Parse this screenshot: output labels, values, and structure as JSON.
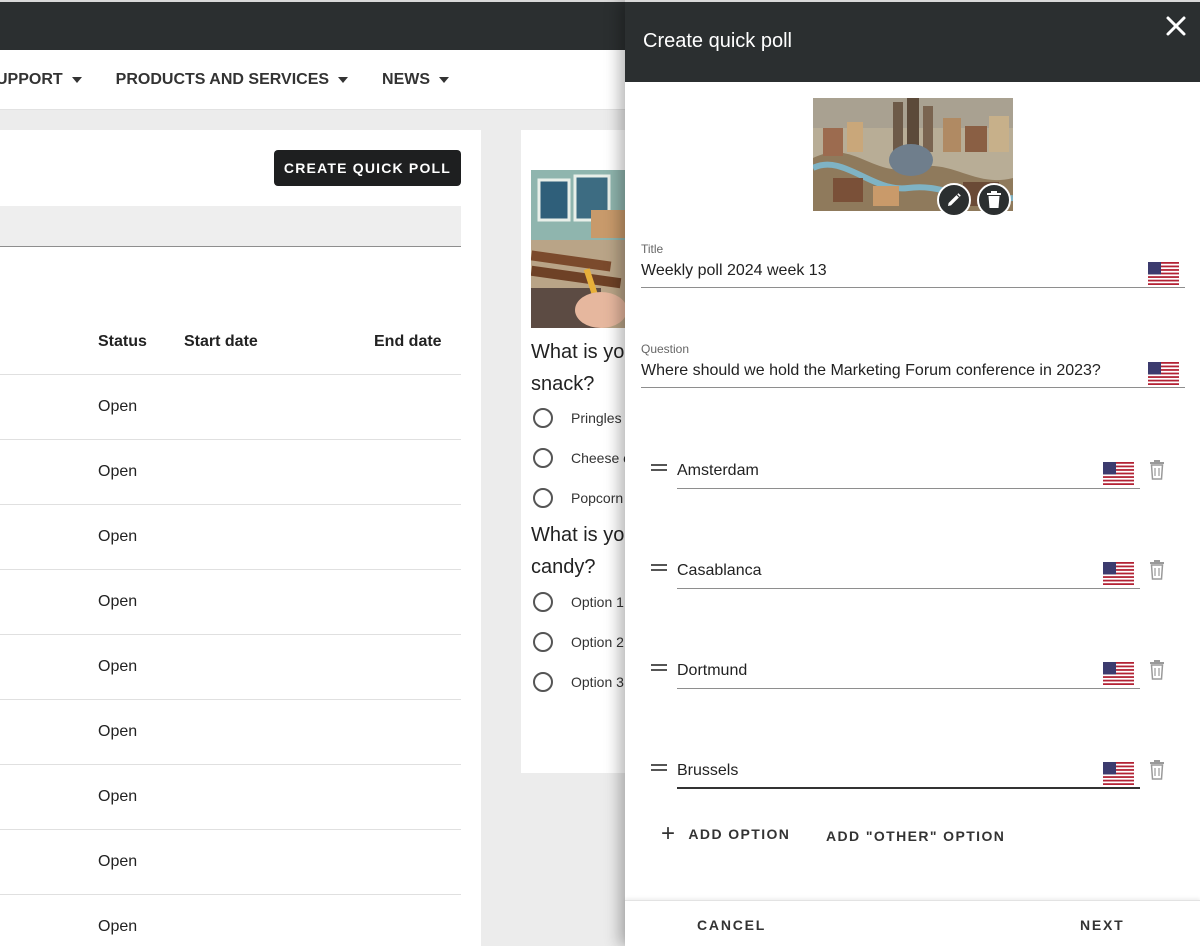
{
  "nav": {
    "items": [
      {
        "label": "UPPORT"
      },
      {
        "label": "PRODUCTS AND SERVICES"
      },
      {
        "label": "NEWS"
      }
    ]
  },
  "list": {
    "create_button": "CREATE QUICK POLL",
    "columns": {
      "status": "Status",
      "start": "Start date",
      "end": "End date"
    },
    "rows": [
      {
        "status": "Open"
      },
      {
        "status": "Open"
      },
      {
        "status": "Open"
      },
      {
        "status": "Open"
      },
      {
        "status": "Open"
      },
      {
        "status": "Open"
      },
      {
        "status": "Open"
      },
      {
        "status": "Open"
      },
      {
        "status": "Open"
      }
    ]
  },
  "preview": {
    "q1": {
      "line1": "What is yo",
      "line2": "snack?"
    },
    "q1_options": [
      "Pringles",
      "Cheese c",
      "Popcorn"
    ],
    "q2": {
      "line1": "What is yo",
      "line2": "candy?"
    },
    "q2_options": [
      "Option 1",
      "Option 2",
      "Option 3"
    ]
  },
  "drawer": {
    "title": "Create quick poll",
    "title_field": {
      "label": "Title",
      "value": "Weekly poll 2024 week 13"
    },
    "question_field": {
      "label": "Question",
      "value": "Where should we hold the Marketing Forum conference in 2023?"
    },
    "options": [
      {
        "value": "Amsterdam"
      },
      {
        "value": "Casablanca"
      },
      {
        "value": "Dortmund"
      },
      {
        "value": "Brussels"
      }
    ],
    "add_option": "ADD OPTION",
    "add_other": "ADD \"OTHER\" OPTION",
    "cancel": "CANCEL",
    "next": "NEXT"
  },
  "icons": {
    "close": "close-icon",
    "edit": "pencil-icon",
    "delete": "trash-icon",
    "language": "us-flag-icon",
    "drag": "drag-handle-icon",
    "add": "plus-icon"
  },
  "colors": {
    "header_dark": "#2b2f30",
    "button_dark": "#1e1f20",
    "flag_red": "#b22234",
    "flag_blue": "#3c3b6e"
  }
}
